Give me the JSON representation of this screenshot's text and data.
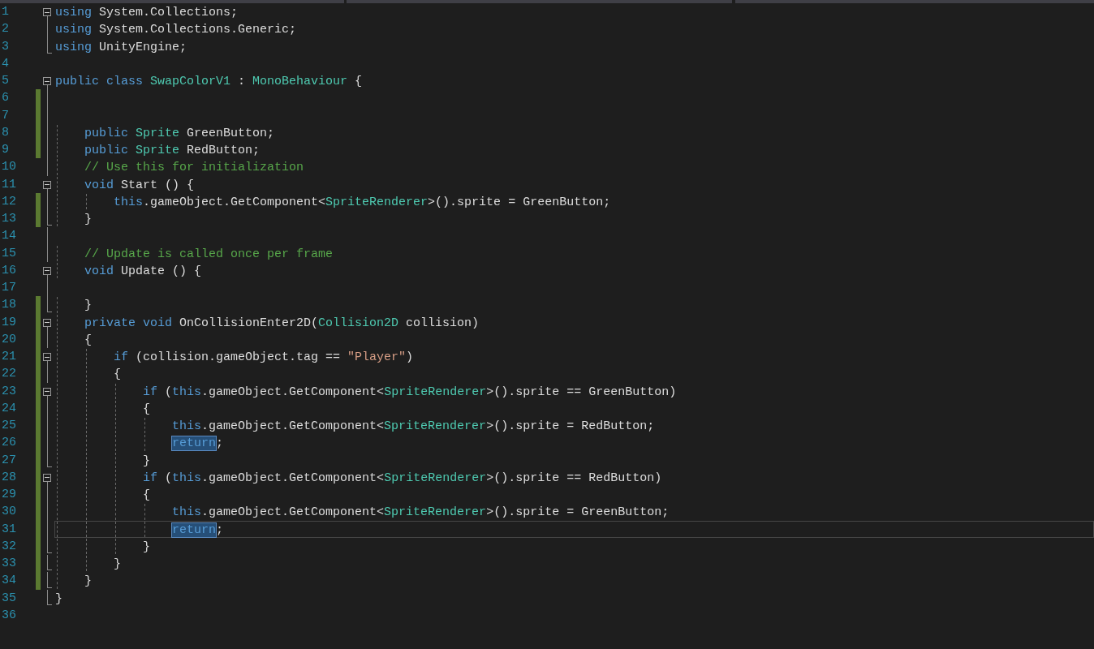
{
  "editor": {
    "lines": [
      {
        "number": "1",
        "changed": false,
        "kind": "fold-start",
        "current": false,
        "tokens": [
          {
            "kind": "keyword",
            "text": "using "
          },
          {
            "kind": "text",
            "text": "System.Collections;"
          }
        ]
      },
      {
        "number": "2",
        "changed": false,
        "kind": "fold-inside",
        "current": false,
        "tokens": [
          {
            "kind": "keyword",
            "text": "using "
          },
          {
            "kind": "text",
            "text": "System.Collections.Generic;"
          }
        ]
      },
      {
        "number": "3",
        "changed": false,
        "kind": "fold-end",
        "current": false,
        "tokens": [
          {
            "kind": "keyword",
            "text": "using "
          },
          {
            "kind": "text",
            "text": "UnityEngine;"
          }
        ]
      },
      {
        "number": "4",
        "changed": false,
        "kind": "plain",
        "current": false
      },
      {
        "number": "5",
        "changed": false,
        "kind": "fold-start",
        "current": false,
        "tokens": [
          {
            "kind": "keyword",
            "text": "public class "
          },
          {
            "kind": "type",
            "text": "SwapColorV1"
          },
          {
            "kind": "text",
            "text": " : "
          },
          {
            "kind": "type",
            "text": "MonoBehaviour"
          },
          {
            "kind": "text",
            "text": " {"
          }
        ]
      },
      {
        "number": "6",
        "changed": true,
        "kind": "fold-inside",
        "current": false
      },
      {
        "number": "7",
        "changed": true,
        "kind": "fold-inside",
        "current": false
      },
      {
        "number": "8",
        "changed": true,
        "kind": "fold-inside",
        "current": false,
        "tokens": [
          {
            "kind": "keyword",
            "text": "    public "
          },
          {
            "kind": "type",
            "text": "Sprite"
          },
          {
            "kind": "text",
            "text": " GreenButton;"
          }
        ]
      },
      {
        "number": "9",
        "changed": true,
        "kind": "fold-inside",
        "current": false,
        "tokens": [
          {
            "kind": "keyword",
            "text": "    public "
          },
          {
            "kind": "type",
            "text": "Sprite"
          },
          {
            "kind": "text",
            "text": " RedButton;"
          }
        ]
      },
      {
        "number": "10",
        "changed": false,
        "kind": "fold-inside",
        "current": false,
        "tokens": [
          {
            "kind": "comment",
            "text": "    // Use this for initialization"
          }
        ]
      },
      {
        "number": "11",
        "changed": false,
        "kind": "fold-start",
        "current": false,
        "tokens": [
          {
            "kind": "keyword",
            "text": "    void"
          },
          {
            "kind": "text",
            "text": " Start () {"
          }
        ]
      },
      {
        "number": "12",
        "changed": true,
        "kind": "fold-inside",
        "current": false,
        "tokens": [
          {
            "kind": "keyword",
            "text": "        this"
          },
          {
            "kind": "text",
            "text": ".gameObject.GetComponent<"
          },
          {
            "kind": "type",
            "text": "SpriteRenderer"
          },
          {
            "kind": "text",
            "text": ">().sprite = GreenButton;"
          }
        ]
      },
      {
        "number": "13",
        "changed": true,
        "kind": "fold-end",
        "current": false,
        "tokens": [
          {
            "kind": "text",
            "text": "    }"
          }
        ]
      },
      {
        "number": "14",
        "changed": false,
        "kind": "fold-inside",
        "current": false
      },
      {
        "number": "15",
        "changed": false,
        "kind": "fold-inside",
        "current": false,
        "tokens": [
          {
            "kind": "comment",
            "text": "    // Update is called once per frame"
          }
        ]
      },
      {
        "number": "16",
        "changed": false,
        "kind": "fold-start",
        "current": false,
        "tokens": [
          {
            "kind": "keyword",
            "text": "    void"
          },
          {
            "kind": "text",
            "text": " Update () {"
          }
        ]
      },
      {
        "number": "17",
        "changed": false,
        "kind": "fold-inside",
        "current": false
      },
      {
        "number": "18",
        "changed": true,
        "kind": "fold-end",
        "current": false,
        "tokens": [
          {
            "kind": "text",
            "text": "    }"
          }
        ]
      },
      {
        "number": "19",
        "changed": true,
        "kind": "fold-start",
        "current": false,
        "tokens": [
          {
            "kind": "keyword",
            "text": "    private void"
          },
          {
            "kind": "text",
            "text": " OnCollisionEnter2D("
          },
          {
            "kind": "type",
            "text": "Collision2D"
          },
          {
            "kind": "text",
            "text": " collision)"
          }
        ]
      },
      {
        "number": "20",
        "changed": true,
        "kind": "fold-inside",
        "current": false,
        "tokens": [
          {
            "kind": "text",
            "text": "    {"
          }
        ]
      },
      {
        "number": "21",
        "changed": true,
        "kind": "fold-start",
        "current": false,
        "tokens": [
          {
            "kind": "keyword",
            "text": "        if"
          },
          {
            "kind": "text",
            "text": " (collision.gameObject.tag == "
          },
          {
            "kind": "string",
            "text": "\"Player\""
          },
          {
            "kind": "text",
            "text": ")"
          }
        ]
      },
      {
        "number": "22",
        "changed": true,
        "kind": "fold-inside",
        "current": false,
        "tokens": [
          {
            "kind": "text",
            "text": "        {"
          }
        ]
      },
      {
        "number": "23",
        "changed": true,
        "kind": "fold-start",
        "current": false,
        "tokens": [
          {
            "kind": "keyword",
            "text": "            if"
          },
          {
            "kind": "text",
            "text": " ("
          },
          {
            "kind": "keyword",
            "text": "this"
          },
          {
            "kind": "text",
            "text": ".gameObject.GetComponent<"
          },
          {
            "kind": "type",
            "text": "SpriteRenderer"
          },
          {
            "kind": "text",
            "text": ">().sprite == GreenButton)"
          }
        ]
      },
      {
        "number": "24",
        "changed": true,
        "kind": "fold-inside",
        "current": false,
        "tokens": [
          {
            "kind": "text",
            "text": "            {"
          }
        ]
      },
      {
        "number": "25",
        "changed": true,
        "kind": "fold-inside",
        "current": false,
        "tokens": [
          {
            "kind": "keyword",
            "text": "                this"
          },
          {
            "kind": "text",
            "text": ".gameObject.GetComponent<"
          },
          {
            "kind": "type",
            "text": "SpriteRenderer"
          },
          {
            "kind": "text",
            "text": ">().sprite = RedButton;"
          }
        ]
      },
      {
        "number": "26",
        "changed": true,
        "kind": "fold-inside",
        "current": false,
        "tokens": [
          {
            "kind": "keyword-match",
            "text": "                return"
          },
          {
            "kind": "text",
            "text": ";"
          }
        ]
      },
      {
        "number": "27",
        "changed": true,
        "kind": "fold-end",
        "current": false,
        "tokens": [
          {
            "kind": "text",
            "text": "            }"
          }
        ]
      },
      {
        "number": "28",
        "changed": true,
        "kind": "fold-start",
        "current": false,
        "tokens": [
          {
            "kind": "keyword",
            "text": "            if"
          },
          {
            "kind": "text",
            "text": " ("
          },
          {
            "kind": "keyword",
            "text": "this"
          },
          {
            "kind": "text",
            "text": ".gameObject.GetComponent<"
          },
          {
            "kind": "type",
            "text": "SpriteRenderer"
          },
          {
            "kind": "text",
            "text": ">().sprite == RedButton)"
          }
        ]
      },
      {
        "number": "29",
        "changed": true,
        "kind": "fold-inside",
        "current": false,
        "tokens": [
          {
            "kind": "text",
            "text": "            {"
          }
        ]
      },
      {
        "number": "30",
        "changed": true,
        "kind": "fold-inside",
        "current": false,
        "tokens": [
          {
            "kind": "keyword",
            "text": "                this"
          },
          {
            "kind": "text",
            "text": ".gameObject.GetComponent<"
          },
          {
            "kind": "type",
            "text": "SpriteRenderer"
          },
          {
            "kind": "text",
            "text": ">().sprite = GreenButton;"
          }
        ]
      },
      {
        "number": "31",
        "changed": true,
        "kind": "fold-inside",
        "current": true,
        "tokens": [
          {
            "kind": "keyword-match",
            "text": "                return"
          },
          {
            "kind": "text",
            "text": ";"
          }
        ]
      },
      {
        "number": "32",
        "changed": true,
        "kind": "fold-end",
        "current": false,
        "tokens": [
          {
            "kind": "text",
            "text": "            }"
          }
        ]
      },
      {
        "number": "33",
        "changed": true,
        "kind": "fold-end",
        "current": false,
        "tokens": [
          {
            "kind": "text",
            "text": "        }"
          }
        ]
      },
      {
        "number": "34",
        "changed": true,
        "kind": "fold-end",
        "current": false,
        "tokens": [
          {
            "kind": "text",
            "text": "    }"
          }
        ]
      },
      {
        "number": "35",
        "changed": false,
        "kind": "fold-end",
        "current": false,
        "tokens": [
          {
            "kind": "text",
            "text": "}"
          }
        ]
      },
      {
        "number": "36",
        "changed": false,
        "kind": "plain",
        "current": false
      }
    ]
  }
}
